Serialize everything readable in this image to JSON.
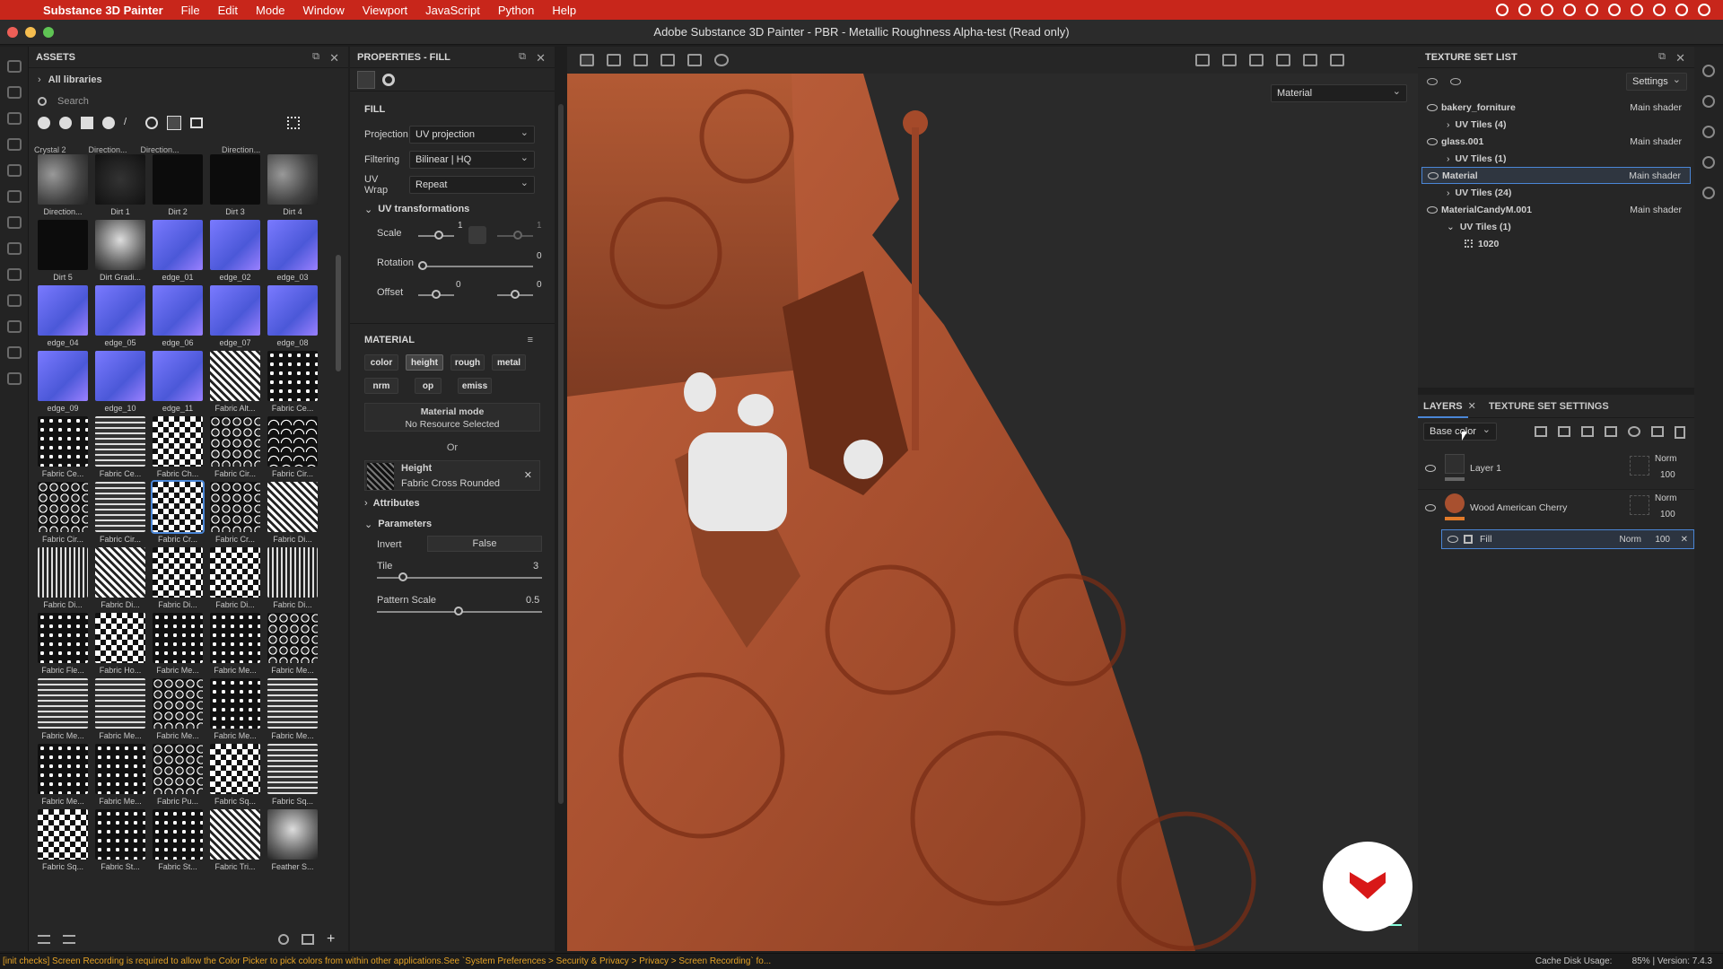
{
  "menubar": {
    "app": "Substance 3D Painter",
    "items": [
      "File",
      "Edit",
      "Mode",
      "Window",
      "Viewport",
      "JavaScript",
      "Python",
      "Help"
    ]
  },
  "window": {
    "title": "Adobe Substance 3D Painter - PBR - Metallic Roughness Alpha-test (Read only)"
  },
  "assets": {
    "title": "ASSETS",
    "library": "All libraries",
    "search_placeholder": "Search",
    "thumbs": [
      {
        "label": "Direction...",
        "style": "grunge"
      },
      {
        "label": "Dirt 1",
        "style": "dark"
      },
      {
        "label": "Dirt 2",
        "style": "black"
      },
      {
        "label": "Dirt 3",
        "style": "black"
      },
      {
        "label": "Dirt 4",
        "style": "grunge"
      },
      {
        "label": "Dirt 5",
        "style": "black"
      },
      {
        "label": "Dirt Gradi...",
        "style": "cloud"
      },
      {
        "label": "edge_01",
        "style": "edge"
      },
      {
        "label": "edge_02",
        "style": "edge"
      },
      {
        "label": "edge_03",
        "style": "edge"
      },
      {
        "label": "edge_04",
        "style": "edge"
      },
      {
        "label": "edge_05",
        "style": "edge"
      },
      {
        "label": "edge_06",
        "style": "edge"
      },
      {
        "label": "edge_07",
        "style": "edge"
      },
      {
        "label": "edge_08",
        "style": "edge"
      },
      {
        "label": "edge_09",
        "style": "edge"
      },
      {
        "label": "edge_10",
        "style": "edge"
      },
      {
        "label": "edge_11",
        "style": "edge"
      },
      {
        "label": "Fabric Alt...",
        "style": "zig"
      },
      {
        "label": "Fabric Ce...",
        "style": "dots"
      },
      {
        "label": "Fabric Ce...",
        "style": "dots"
      },
      {
        "label": "Fabric Ce...",
        "style": "grid"
      },
      {
        "label": "Fabric Ch...",
        "style": "check"
      },
      {
        "label": "Fabric Cir...",
        "style": "rings"
      },
      {
        "label": "Fabric Cir...",
        "style": "scales"
      },
      {
        "label": "Fabric Cir...",
        "style": "rings"
      },
      {
        "label": "Fabric Cir...",
        "style": "grid"
      },
      {
        "label": "Fabric Cr...",
        "style": "check"
      },
      {
        "label": "Fabric Cr...",
        "style": "rings"
      },
      {
        "label": "Fabric Di...",
        "style": "zig"
      },
      {
        "label": "Fabric Di...",
        "style": "lines"
      },
      {
        "label": "Fabric Di...",
        "style": "zig"
      },
      {
        "label": "Fabric Di...",
        "style": "check"
      },
      {
        "label": "Fabric Di...",
        "style": "check"
      },
      {
        "label": "Fabric Di...",
        "style": "lines"
      },
      {
        "label": "Fabric Fle...",
        "style": "dots"
      },
      {
        "label": "Fabric Ho...",
        "style": "check"
      },
      {
        "label": "Fabric Me...",
        "style": "dots"
      },
      {
        "label": "Fabric Me...",
        "style": "dots"
      },
      {
        "label": "Fabric Me...",
        "style": "rings"
      },
      {
        "label": "Fabric Me...",
        "style": "grid"
      },
      {
        "label": "Fabric Me...",
        "style": "grid"
      },
      {
        "label": "Fabric Me...",
        "style": "rings"
      },
      {
        "label": "Fabric Me...",
        "style": "dots"
      },
      {
        "label": "Fabric Me...",
        "style": "grid"
      },
      {
        "label": "Fabric Me...",
        "style": "dots"
      },
      {
        "label": "Fabric Me...",
        "style": "dots"
      },
      {
        "label": "Fabric Pu...",
        "style": "rings"
      },
      {
        "label": "Fabric Sq...",
        "style": "check"
      },
      {
        "label": "Fabric Sq...",
        "style": "grid"
      },
      {
        "label": "Fabric Sq...",
        "style": "check"
      },
      {
        "label": "Fabric St...",
        "style": "dots"
      },
      {
        "label": "Fabric St...",
        "style": "dots"
      },
      {
        "label": "Fabric Tri...",
        "style": "zig"
      },
      {
        "label": "Feather S...",
        "style": "cloud"
      }
    ]
  },
  "properties": {
    "title": "PROPERTIES - FILL",
    "section_fill": "FILL",
    "projection": {
      "label": "Projection",
      "value": "UV projection"
    },
    "filtering": {
      "label": "Filtering",
      "value": "Bilinear | HQ"
    },
    "uvwrap": {
      "label": "UV Wrap",
      "value": "Repeat"
    },
    "uvtrans": "UV transformations",
    "scale": {
      "label": "Scale",
      "value": "1",
      "value2": "1"
    },
    "rotation": {
      "label": "Rotation",
      "value": "0"
    },
    "offset": {
      "label": "Offset",
      "value": "0",
      "value2": "0"
    },
    "section_material": "MATERIAL",
    "channels": [
      "color",
      "height",
      "rough",
      "metal",
      "nrm",
      "op",
      "emiss"
    ],
    "material_mode": "Material mode",
    "no_resource": "No Resource Selected",
    "or": "Or",
    "height_label": "Height",
    "height_resource": "Fabric Cross Rounded",
    "attributes": "Attributes",
    "parameters": "Parameters",
    "invert": {
      "label": "Invert",
      "value": "False"
    },
    "tile": {
      "label": "Tile",
      "value": "3"
    },
    "pattern_scale": {
      "label": "Pattern Scale",
      "value": "0.5"
    }
  },
  "viewport": {
    "mode": "Material"
  },
  "texture_set": {
    "title": "TEXTURE SET LIST",
    "settings": "Settings",
    "rows": [
      {
        "name": "bakery_forniture",
        "shader": "Main shader",
        "tiles": "UV Tiles (4)"
      },
      {
        "name": "glass.001",
        "shader": "Main shader",
        "tiles": "UV Tiles (1)"
      },
      {
        "name": "Material",
        "shader": "Main shader",
        "tiles": "UV Tiles (24)"
      },
      {
        "name": "MaterialCandyM.001",
        "shader": "Main shader",
        "tiles": "UV Tiles (1)",
        "tile_item": "1020"
      }
    ]
  },
  "layers": {
    "tab1": "LAYERS",
    "tab2": "TEXTURE SET SETTINGS",
    "channel": "Base color",
    "items": [
      {
        "name": "Layer 1",
        "blend": "Norm",
        "opacity": "100"
      },
      {
        "name": "Wood American Cherry",
        "blend": "Norm",
        "opacity": "100"
      }
    ],
    "fill": {
      "name": "Fill",
      "blend": "Norm",
      "opacity": "100"
    }
  },
  "status": {
    "message": "[init checks] Screen Recording is required to allow the Color Picker to pick colors from within other applications.See `System Preferences > Security & Privacy > Privacy > Screen Recording` fo...",
    "cache": "Cache Disk Usage:",
    "version": "85% | Version: 7.4.3"
  }
}
